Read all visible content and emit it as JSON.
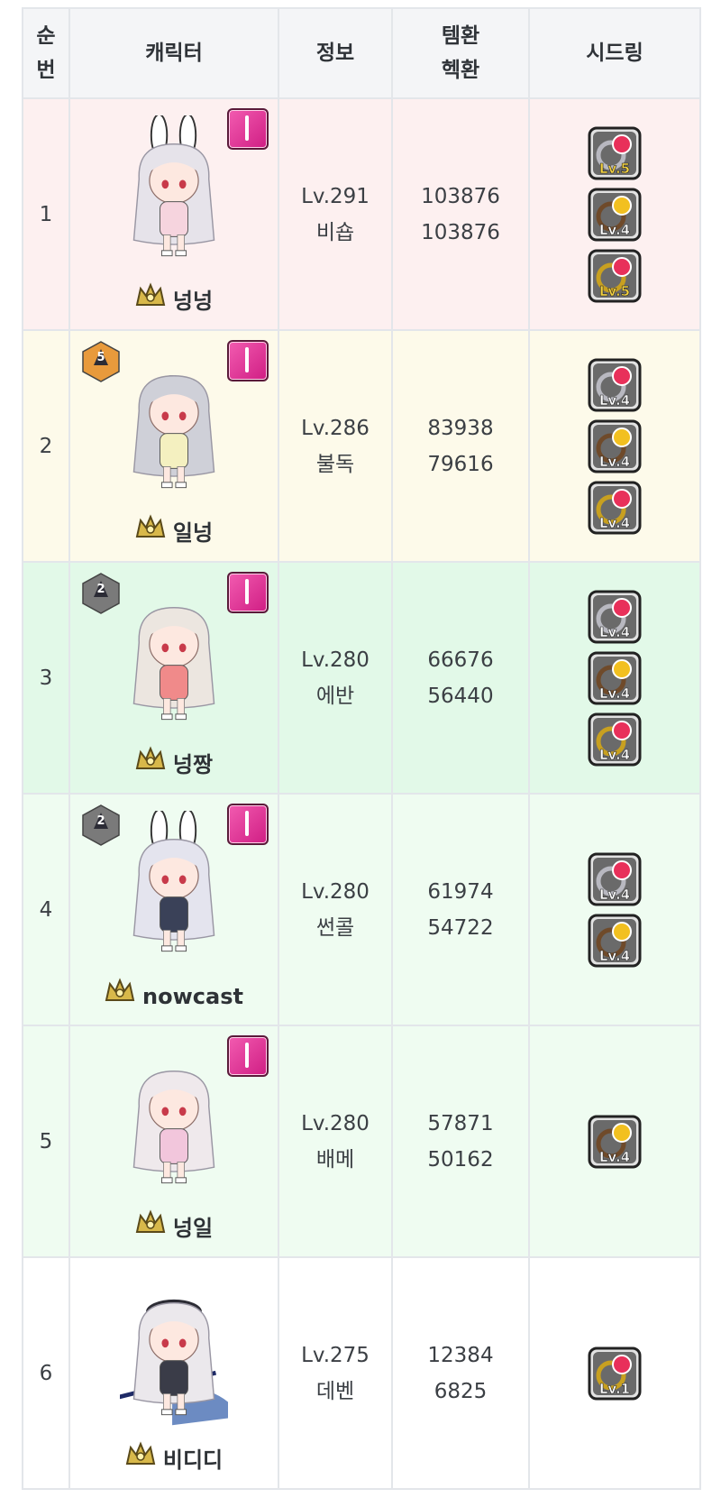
{
  "headers": [
    "순\n번",
    "캐릭터",
    "정보",
    "템환\n헥환",
    "시드링"
  ],
  "rows": [
    {
      "rank": "1",
      "name": "넝넝",
      "level": "Lv.291",
      "job": "비숍",
      "tem": "103876",
      "hek": "103876",
      "boss_icon": "pink-boss-icon",
      "badge": null,
      "avatar": "white-bunny-girl",
      "seeds": [
        {
          "type": "pink",
          "label": "Lv.5"
        },
        {
          "type": "brown",
          "label": "Lv.4"
        },
        {
          "type": "gold",
          "label": "Lv.5"
        }
      ]
    },
    {
      "rank": "2",
      "name": "일넝",
      "level": "Lv.286",
      "job": "불독",
      "tem": "83938",
      "hek": "79616",
      "boss_icon": "pink-boss-icon",
      "badge": {
        "num": "5",
        "color": "#e89a3c"
      },
      "avatar": "silver-boy",
      "seeds": [
        {
          "type": "pink",
          "label": "Lv.4"
        },
        {
          "type": "brown",
          "label": "Lv.4"
        },
        {
          "type": "gold",
          "label": "Lv.4"
        }
      ]
    },
    {
      "rank": "3",
      "name": "넝짱",
      "level": "Lv.280",
      "job": "에반",
      "tem": "66676",
      "hek": "56440",
      "boss_icon": "pink-boss-icon",
      "badge": {
        "num": "2",
        "color": "#7a7a7a"
      },
      "avatar": "bonnet-girl",
      "seeds": [
        {
          "type": "pink",
          "label": "Lv.4"
        },
        {
          "type": "brown",
          "label": "Lv.4"
        },
        {
          "type": "gold",
          "label": "Lv.4"
        }
      ]
    },
    {
      "rank": "4",
      "name": "nowcast",
      "level": "Lv.280",
      "job": "썬콜",
      "tem": "61974",
      "hek": "54722",
      "boss_icon": "pink-boss-icon",
      "badge": {
        "num": "2",
        "color": "#7a7a7a"
      },
      "avatar": "clock-bunny-girl",
      "seeds": [
        {
          "type": "pink",
          "label": "Lv.4"
        },
        {
          "type": "brown",
          "label": "Lv.4"
        }
      ]
    },
    {
      "rank": "5",
      "name": "넝일",
      "level": "Lv.280",
      "job": "배메",
      "tem": "57871",
      "hek": "50162",
      "boss_icon": "pink-boss-icon",
      "badge": null,
      "avatar": "pink-dress-girl",
      "seeds": [
        {
          "type": "brown",
          "label": "Lv.4"
        }
      ]
    },
    {
      "rank": "6",
      "name": "비디디",
      "level": "Lv.275",
      "job": "데벤",
      "tem": "12384",
      "hek": "6825",
      "boss_icon": null,
      "badge": null,
      "avatar": "sailor-boy",
      "seeds": [
        {
          "type": "gold",
          "label": "Lv.1"
        }
      ]
    }
  ],
  "colors": {
    "row1": "#fdf0f0",
    "row2": "#fdfaea",
    "row3": "#e2f9e8",
    "row4": "#effcf1",
    "row5": "#effcf1",
    "row6": "#ffffff",
    "border": "#e3e6ea",
    "header": "#f4f5f7"
  }
}
